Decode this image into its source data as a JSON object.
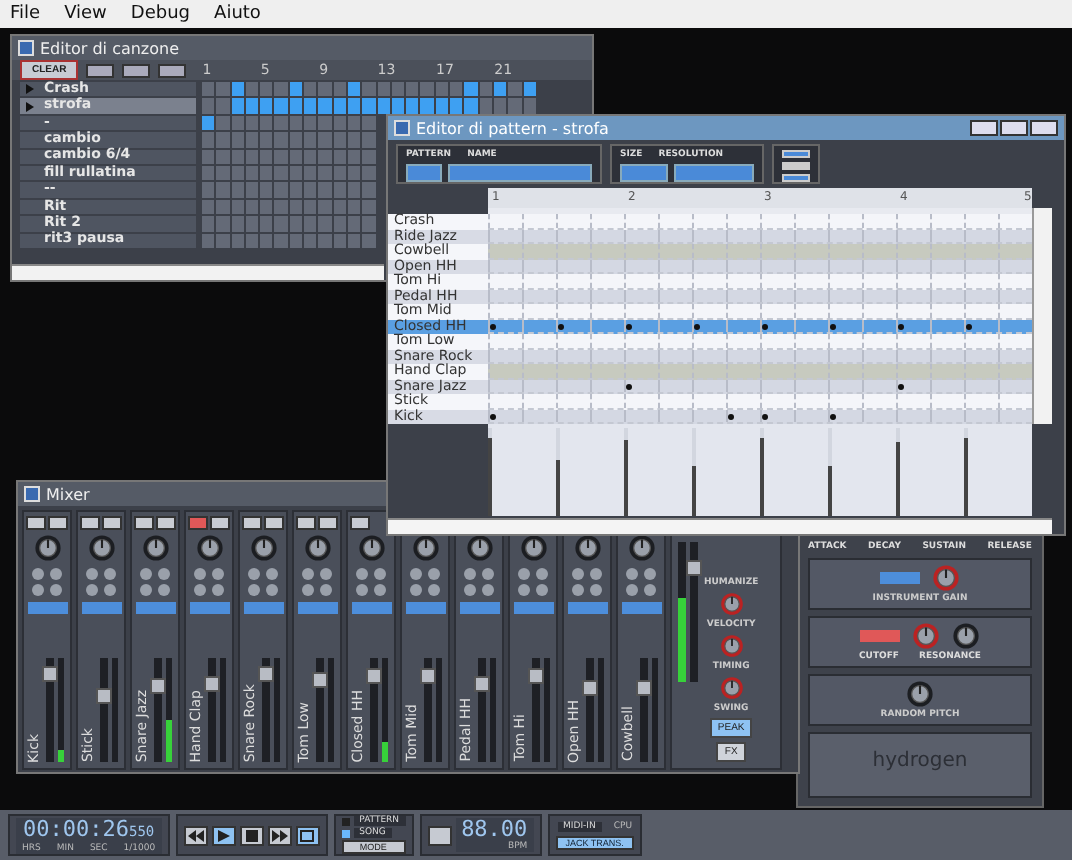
{
  "menu": [
    {
      "label": "File"
    },
    {
      "label": "View"
    },
    {
      "label": "Debug"
    },
    {
      "label": "Aiuto"
    }
  ],
  "song_editor": {
    "title": "Editor di canzone",
    "clear_label": "CLEAR",
    "ruler": [
      "1",
      "5",
      "9",
      "13",
      "17",
      "21"
    ],
    "patterns": [
      {
        "name": "Crash",
        "selected": false,
        "cells": [
          false,
          false,
          true,
          false,
          false,
          false,
          true,
          false,
          false,
          false,
          true,
          false,
          false,
          false,
          false,
          false,
          false,
          false,
          true,
          false,
          true,
          false,
          true
        ]
      },
      {
        "name": "strofa",
        "selected": true,
        "cells": [
          false,
          false,
          true,
          true,
          true,
          true,
          true,
          true,
          true,
          true,
          true,
          true,
          true,
          true,
          true,
          true,
          true,
          true,
          true,
          false,
          false,
          false,
          false
        ]
      },
      {
        "name": "-",
        "selected": false,
        "cells": [
          true,
          false,
          false,
          false,
          false,
          false,
          false,
          false,
          false,
          false,
          false,
          false
        ]
      },
      {
        "name": "cambio",
        "selected": false,
        "cells": [
          false,
          false,
          false,
          false,
          false,
          false,
          false,
          false,
          false,
          false,
          false,
          false
        ]
      },
      {
        "name": "cambio 6/4",
        "selected": false,
        "cells": [
          false,
          false,
          false,
          false,
          false,
          false,
          false,
          false,
          false,
          false,
          false,
          false
        ]
      },
      {
        "name": "fill rullatina",
        "selected": false,
        "cells": [
          false,
          false,
          false,
          false,
          false,
          false,
          false,
          false,
          false,
          false,
          false,
          false
        ]
      },
      {
        "name": "--",
        "selected": false,
        "cells": [
          false,
          false,
          false,
          false,
          false,
          false,
          false,
          false,
          false,
          false,
          false,
          false
        ]
      },
      {
        "name": "Rit",
        "selected": false,
        "cells": [
          false,
          false,
          false,
          false,
          false,
          false,
          false,
          false,
          false,
          false,
          false,
          false
        ]
      },
      {
        "name": "Rit 2",
        "selected": false,
        "cells": [
          false,
          false,
          false,
          false,
          false,
          false,
          false,
          false,
          false,
          false,
          false,
          false
        ]
      },
      {
        "name": "rit3 pausa",
        "selected": false,
        "cells": [
          false,
          false,
          false,
          false,
          false,
          false,
          false,
          false,
          false,
          false,
          false,
          false
        ]
      }
    ]
  },
  "pattern_editor": {
    "title": "Editor di pattern - strofa",
    "toolbar_labels": [
      "PATTERN",
      "NAME",
      "SIZE",
      "RESOLUTION"
    ],
    "ruler": [
      "1",
      "2",
      "3",
      "4",
      "5"
    ],
    "instruments": [
      {
        "name": "Crash",
        "selected": false,
        "shaded": false
      },
      {
        "name": "Ride Jazz",
        "selected": false,
        "shaded": false
      },
      {
        "name": "Cowbell",
        "selected": false,
        "shaded": true
      },
      {
        "name": "Open HH",
        "selected": false,
        "shaded": false
      },
      {
        "name": "Tom Hi",
        "selected": false,
        "shaded": false
      },
      {
        "name": "Pedal HH",
        "selected": false,
        "shaded": false
      },
      {
        "name": "Tom Mid",
        "selected": false,
        "shaded": false
      },
      {
        "name": "Closed HH",
        "selected": true,
        "shaded": false,
        "notes": [
          true,
          false,
          true,
          false,
          true,
          false,
          true,
          false,
          true,
          false,
          true,
          false,
          true,
          false,
          true,
          false
        ]
      },
      {
        "name": "Tom Low",
        "selected": false,
        "shaded": false
      },
      {
        "name": "Snare Rock",
        "selected": false,
        "shaded": false
      },
      {
        "name": "Hand Clap",
        "selected": false,
        "shaded": true
      },
      {
        "name": "Snare Jazz",
        "selected": false,
        "shaded": false,
        "notes": [
          false,
          false,
          false,
          false,
          true,
          false,
          false,
          false,
          false,
          false,
          false,
          false,
          true,
          false,
          false,
          false
        ]
      },
      {
        "name": "Stick",
        "selected": false,
        "shaded": false
      },
      {
        "name": "Kick",
        "selected": false,
        "shaded": false,
        "notes": [
          true,
          false,
          false,
          false,
          false,
          false,
          false,
          true,
          true,
          false,
          true,
          false,
          false,
          false,
          false,
          false
        ]
      }
    ],
    "velocity_bars": [
      {
        "level": 0.9
      },
      {
        "level": 0.65
      },
      {
        "level": 0.88
      },
      {
        "level": 0.58
      },
      {
        "level": 0.9
      },
      {
        "level": 0.57
      },
      {
        "level": 0.84
      },
      {
        "level": 0.9
      }
    ]
  },
  "mixer": {
    "title": "Mixer",
    "strips": [
      {
        "name": "Kick",
        "muted": false,
        "solo": false,
        "fader": {
          "level": 0.9
        },
        "meter": {
          "level": 0.12
        }
      },
      {
        "name": "Stick",
        "muted": false,
        "solo": false,
        "fader": {
          "level": 0.66
        },
        "meter": {
          "level": 0
        }
      },
      {
        "name": "Snare Jazz",
        "muted": false,
        "solo": false,
        "fader": {
          "level": 0.78
        },
        "meter": {
          "level": 0.4
        }
      },
      {
        "name": "Hand Clap",
        "muted": true,
        "solo": false,
        "fader": {
          "level": 0.8
        },
        "meter": {
          "level": 0
        }
      },
      {
        "name": "Snare Rock",
        "muted": false,
        "solo": false,
        "fader": {
          "level": 0.9
        },
        "meter": {
          "level": 0
        }
      },
      {
        "name": "Tom Low",
        "muted": false,
        "solo": false,
        "fader": {
          "level": 0.85
        },
        "meter": {
          "level": 0
        }
      },
      {
        "name": "Closed HH",
        "muted": false,
        "fader": {
          "level": 0.88
        },
        "meter": {
          "level": 0.2
        }
      },
      {
        "name": "Tom Mid",
        "fader": {
          "level": 0.88
        },
        "meter": {
          "level": 0
        }
      },
      {
        "name": "Pedal HH",
        "fader": {
          "level": 0.8
        },
        "meter": {
          "level": 0
        }
      },
      {
        "name": "Tom Hi",
        "fader": {
          "level": 0.88
        },
        "meter": {
          "level": 0
        }
      },
      {
        "name": "Open HH",
        "fader": {
          "level": 0.75
        },
        "meter": {
          "level": 0
        }
      },
      {
        "name": "Cowbell",
        "fader": {
          "level": 0.75
        },
        "meter": {
          "level": 0
        }
      }
    ],
    "master": {
      "fader": {
        "level": 0.85
      },
      "meter": {
        "level": 0.6
      },
      "knob_labels": [
        "HUMANIZE",
        "VELOCITY",
        "TIMING",
        "SWING"
      ],
      "buttons": [
        {
          "label": "PEAK",
          "on": true
        },
        {
          "label": "FX",
          "on": false
        }
      ]
    }
  },
  "instrument_rack": {
    "adsr_labels": [
      "ATTACK",
      "DECAY",
      "SUSTAIN",
      "RELEASE"
    ],
    "gain_label": "INSTRUMENT GAIN",
    "filter_labels": [
      "CUTOFF",
      "RESONANCE"
    ],
    "pitch_label": "RANDOM PITCH",
    "logo": "hydrogen"
  },
  "transport": {
    "time": "00:00:26",
    "millis": "550",
    "time_units": [
      "HRS",
      "MIN",
      "SEC",
      "1/1000"
    ],
    "mode_options": [
      {
        "label": "PATTERN",
        "selected": false
      },
      {
        "label": "SONG",
        "selected": true
      }
    ],
    "mode_button": "MODE",
    "bpm": "88.00",
    "bpm_label": "BPM",
    "midi_label": "MIDI-IN",
    "cpu_label": "CPU",
    "jack_button": "JACK TRANS."
  }
}
